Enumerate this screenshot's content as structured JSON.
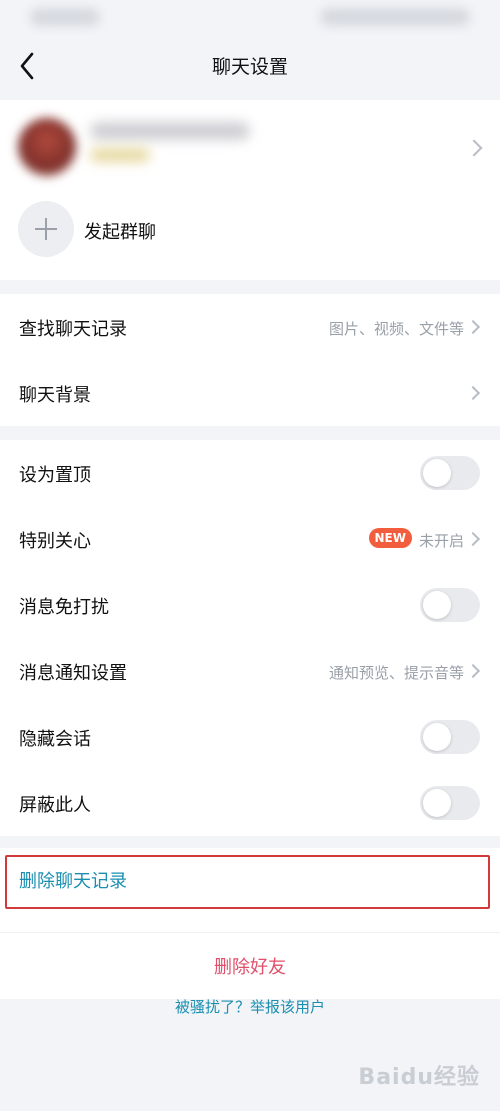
{
  "header": {
    "title": "聊天设置"
  },
  "profile": {
    "group_chat_label": "发起群聊"
  },
  "section1": [
    {
      "label": "查找聊天记录",
      "hint": "图片、视频、文件等"
    },
    {
      "label": "聊天背景",
      "hint": ""
    }
  ],
  "section2": {
    "pin": {
      "label": "设为置顶",
      "on": false
    },
    "special_care": {
      "label": "特别关心",
      "badge": "NEW",
      "hint": "未开启"
    },
    "dnd": {
      "label": "消息免打扰",
      "on": false
    },
    "notify": {
      "label": "消息通知设置",
      "hint": "通知预览、提示音等"
    },
    "hide": {
      "label": "隐藏会话",
      "on": false
    },
    "block": {
      "label": "屏蔽此人",
      "on": false
    }
  },
  "actions": {
    "delete_history": "删除聊天记录",
    "delete_friend": "删除好友",
    "report": "被骚扰了？举报该用户"
  },
  "watermark": "Baidu经验",
  "colors": {
    "accent": "#1a8fb0",
    "danger": "#e0506a",
    "badge": "#f25e3d",
    "highlight_border": "#d03a3a"
  }
}
